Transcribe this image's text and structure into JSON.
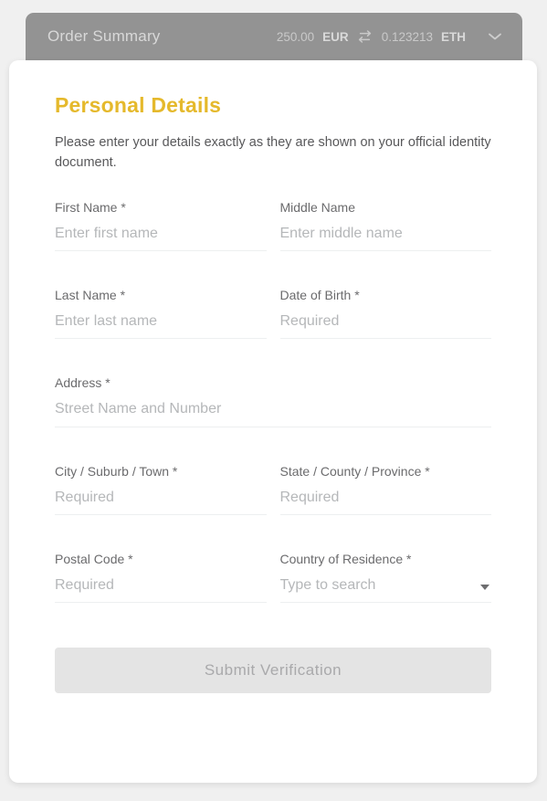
{
  "order_summary": {
    "title": "Order Summary",
    "fiat_amount": "250.00",
    "fiat_currency": "EUR",
    "swap_icon": "swap-horizontal-icon",
    "crypto_amount": "0.123213",
    "crypto_currency": "ETH",
    "expand_icon": "chevron-down-icon",
    "bar_color": "#939393"
  },
  "personal_details": {
    "heading": "Personal Details",
    "heading_color": "#e5b92c",
    "description": "Please enter your details exactly as they are shown on your official identity document.",
    "fields": {
      "first_name": {
        "label": "First Name *",
        "placeholder": "Enter first name",
        "value": ""
      },
      "middle_name": {
        "label": "Middle Name",
        "placeholder": "Enter middle name",
        "value": ""
      },
      "last_name": {
        "label": "Last Name *",
        "placeholder": "Enter last name",
        "value": ""
      },
      "date_of_birth": {
        "label": "Date of Birth *",
        "placeholder": "Required",
        "value": ""
      },
      "address": {
        "label": "Address *",
        "placeholder": "Street Name and Number",
        "value": ""
      },
      "city": {
        "label": "City / Suburb / Town *",
        "placeholder": "Required",
        "value": ""
      },
      "state": {
        "label": "State / County / Province *",
        "placeholder": "Required",
        "value": ""
      },
      "postal_code": {
        "label": "Postal Code *",
        "placeholder": "Required",
        "value": ""
      },
      "country": {
        "label": "Country of Residence *",
        "placeholder": "Type to search",
        "value": "",
        "caret_icon": "dropdown-caret-icon"
      }
    }
  },
  "submit": {
    "label": "Submit Verification",
    "disabled": true,
    "background": "#e4e4e4",
    "text_color": "#a9a9ab"
  }
}
